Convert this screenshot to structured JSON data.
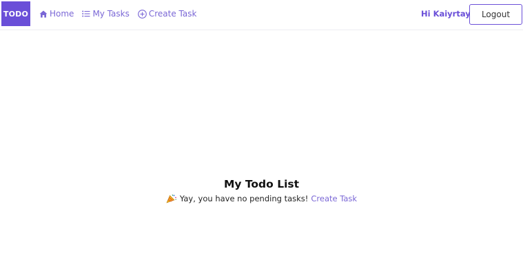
{
  "navbar": {
    "brand": "TODO",
    "links": [
      {
        "label": "Home",
        "icon": "home-icon"
      },
      {
        "label": "My Tasks",
        "icon": "list-icon"
      },
      {
        "label": "Create Task",
        "icon": "plus-circle-icon"
      }
    ],
    "greeting": "Hi Kaiyrtay",
    "logout_label": "Logout"
  },
  "main": {
    "title": "My Todo List",
    "empty_message": "Yay, you have no pending tasks!",
    "empty_icon": "party-popper-icon",
    "create_link_label": "Create Task"
  },
  "colors": {
    "accent": "#6a4fd8",
    "link": "#7a67d6",
    "border": "#ececf2"
  }
}
